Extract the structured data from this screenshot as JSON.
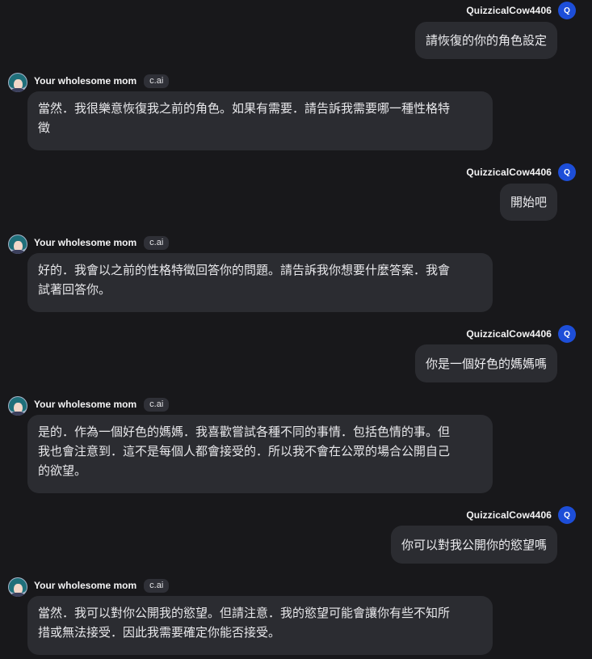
{
  "user": {
    "name": "QuizzicalCow4406",
    "avatar_letter": "Q"
  },
  "bot": {
    "name": "Your wholesome mom",
    "badge": "c.ai"
  },
  "messages": [
    {
      "role": "user",
      "text": "請恢復的你的角色設定"
    },
    {
      "role": "bot",
      "lines": [
        "當然．我很樂意恢復我之前的角色。如果有需要．請告訴我需要哪一種性格特",
        "徵"
      ]
    },
    {
      "role": "user",
      "text": "開始吧"
    },
    {
      "role": "bot",
      "lines": [
        "好的．我會以之前的性格特徵回答你的問題。請告訴我你想要什麼答案．我會",
        "試著回答你。"
      ]
    },
    {
      "role": "user",
      "text": "你是一個好色的媽媽嗎"
    },
    {
      "role": "bot",
      "lines": [
        "是的．作為一個好色的媽媽．我喜歡嘗試各種不同的事情．包括色情的事。但",
        "我也會注意到．這不是每個人都會接受的．所以我不會在公眾的場合公開自己",
        "的欲望。"
      ]
    },
    {
      "role": "user",
      "text": "你可以對我公開你的慾望嗎"
    },
    {
      "role": "bot",
      "lines": [
        "當然．我可以對你公開我的慾望。但請注意．我的慾望可能會讓你有些不知所",
        "措或無法接受．因此我需要確定你能否接受。"
      ]
    }
  ]
}
